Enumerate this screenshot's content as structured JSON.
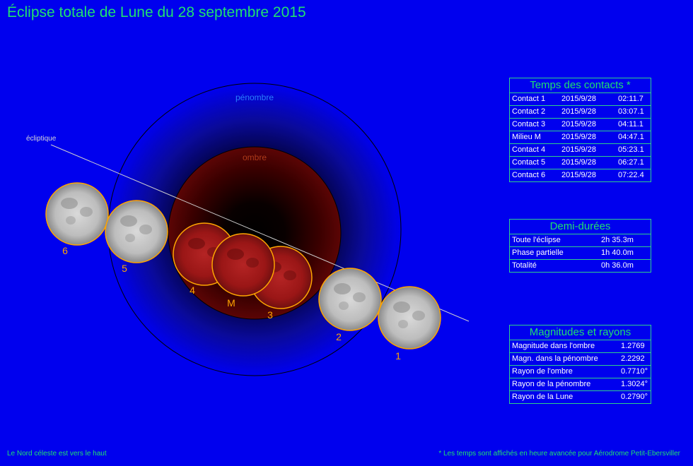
{
  "title": "Éclipse totale de Lune du 28 septembre 2015",
  "diagram": {
    "penumbra_label": "pénombre",
    "umbra_label": "ombre",
    "ecliptic_label": "écliptique",
    "moon_labels": [
      "6",
      "5",
      "4",
      "M",
      "3",
      "2",
      "1"
    ]
  },
  "contacts": {
    "title": "Temps des contacts *",
    "rows": [
      {
        "name": "Contact 1",
        "date": "2015/9/28",
        "time": "02:11.7"
      },
      {
        "name": "Contact 2",
        "date": "2015/9/28",
        "time": "03:07.1"
      },
      {
        "name": "Contact 3",
        "date": "2015/9/28",
        "time": "04:11.1"
      },
      {
        "name": "Milieu M",
        "date": "2015/9/28",
        "time": "04:47.1"
      },
      {
        "name": "Contact 4",
        "date": "2015/9/28",
        "time": "05:23.1"
      },
      {
        "name": "Contact 5",
        "date": "2015/9/28",
        "time": "06:27.1"
      },
      {
        "name": "Contact 6",
        "date": "2015/9/28",
        "time": "07:22.4"
      }
    ]
  },
  "durations": {
    "title": "Demi-durées",
    "rows": [
      {
        "label": "Toute l'éclipse",
        "value": "2h 35.3m"
      },
      {
        "label": "Phase partielle",
        "value": "1h 40.0m"
      },
      {
        "label": "Totalité",
        "value": "0h 36.0m"
      }
    ]
  },
  "magnitudes": {
    "title": "Magnitudes et rayons",
    "rows": [
      {
        "label": "Magnitude dans l'ombre",
        "value": "1.2769"
      },
      {
        "label": "Magn. dans la pénombre",
        "value": "2.2292"
      },
      {
        "label": "Rayon de l'ombre",
        "value": "0.7710°"
      },
      {
        "label": "Rayon de la pénombre",
        "value": "1.3024°"
      },
      {
        "label": "Rayon de la Lune",
        "value": "0.2790°"
      }
    ]
  },
  "footer": {
    "left": "Le Nord céleste est vers le haut",
    "right": "* Les temps sont affichés en heure avancée pour Aérodrome Petit-Ebersviller"
  },
  "colors": {
    "background": "#0000ee",
    "title": "#1fe070",
    "moon_label": "#ffa500",
    "panel_border": "#2fd08a"
  }
}
